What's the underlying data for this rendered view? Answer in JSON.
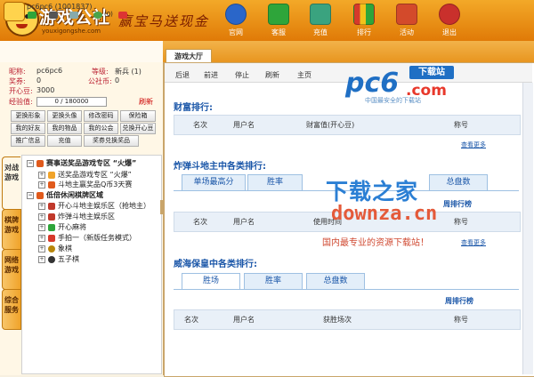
{
  "header": {
    "logo_title": "游戏公社",
    "logo_sub": "youxigongshe.com",
    "slogan": "赢宝马送现金",
    "nav": [
      {
        "label": "官网",
        "color": "#2a66c9"
      },
      {
        "label": "客服",
        "color": "#2ea53a"
      },
      {
        "label": "充值",
        "color": "#3aa37f"
      },
      {
        "label": "排行",
        "color": "#d6392b"
      },
      {
        "label": "活动",
        "color": "#d34a2b"
      },
      {
        "label": "退出",
        "color": "#c9302c"
      }
    ]
  },
  "user": {
    "id_text": "pc6pc6 (1001837)",
    "notify_count": "(0)"
  },
  "tabs": {
    "lobby": "游戏大厅"
  },
  "profile": {
    "nickname_label": "昵称:",
    "nickname": "pc6pc6",
    "level_label": "等级:",
    "level": "新兵 (1)",
    "prize_label": "奖券:",
    "prize": "0",
    "gongyuan_label": "公社币:",
    "gongyuan": "0",
    "happy_label": "开心豆:",
    "happy": "3000",
    "exp_label": "经验值:",
    "exp": "0 / 180000",
    "refresh": "刷新"
  },
  "function_buttons": [
    "更换形象",
    "更换头像",
    "修改密码",
    "保险箱",
    "我的好友",
    "我的物品",
    "我的公会",
    "兑换开心豆",
    "推广信息",
    "充值",
    "奖券兑换奖品"
  ],
  "side_tabs": [
    "对战游戏",
    "棋牌游戏",
    "网络游戏",
    "综合服务"
  ],
  "tree": [
    {
      "text": "赛事送奖品游戏专区 “火爆”",
      "bold": true
    },
    {
      "text": "送奖品游戏专区 “火爆”",
      "bold": false
    },
    {
      "text": "斗地主赢奖品Q币3天赛",
      "bold": false
    },
    {
      "text": "低倍休闲棋牌区域",
      "bold": true
    },
    {
      "text": "开心斗地主娱乐区（抢地主）",
      "bold": false
    },
    {
      "text": "炸弹斗地主娱乐区",
      "bold": false
    },
    {
      "text": "开心麻将",
      "bold": false
    },
    {
      "text": "手拍一（新版任务模式）",
      "bold": false
    },
    {
      "text": "象棋",
      "bold": false
    },
    {
      "text": "五子棋",
      "bold": false
    }
  ],
  "toolbar": [
    "后退",
    "前进",
    "停止",
    "刷新",
    "主页"
  ],
  "wealth": {
    "title": "财富排行:",
    "cols": [
      "名次",
      "用户名",
      "财富值(开心豆)",
      "称号"
    ],
    "more": "查看更多"
  },
  "bomb": {
    "title": "炸弹斗地主中各类排行:",
    "tabs": [
      "单场最高分",
      "胜率",
      "总盘数"
    ],
    "weekly": "周排行榜",
    "cols": [
      "名次",
      "用户名",
      "使用时间",
      "称号"
    ],
    "more": "查看更多"
  },
  "weihai": {
    "title": "威海保皇中各类排行:",
    "tabs": [
      "胜场",
      "胜率",
      "总盘数"
    ],
    "weekly": "周排行榜",
    "cols": [
      "名次",
      "用户名",
      "获胜场次",
      "称号"
    ]
  },
  "watermarks": {
    "pc6": "pc6",
    "pc6_com": ".com",
    "pc6_dl": "下载站",
    "pc6_tag": "中国最安全的下载站",
    "downza_cn": "下载之家",
    "downza_en": "downza.cn",
    "downza_tag": "国内最专业的资源下载站！"
  }
}
